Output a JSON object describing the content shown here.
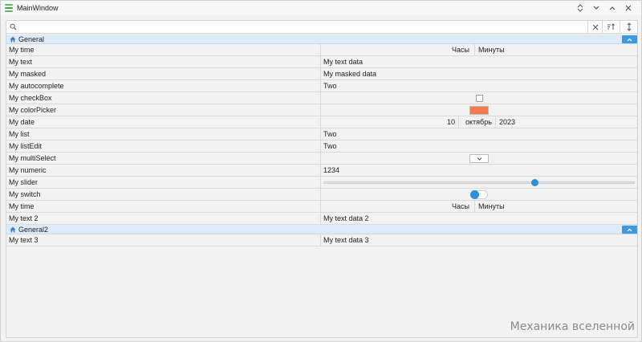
{
  "window": {
    "title": "MainWindow"
  },
  "search": {
    "value": "",
    "placeholder": ""
  },
  "groups": [
    {
      "title": "General",
      "rows": [
        {
          "name": "My time",
          "hours": "Часы",
          "minutes": "Минуты"
        },
        {
          "name": "My text",
          "value": "My text data"
        },
        {
          "name": "My masked",
          "value": "My masked data"
        },
        {
          "name": "My autocomplete",
          "value": "Two"
        },
        {
          "name": "My checkBox",
          "checked": false
        },
        {
          "name": "My colorPicker",
          "color": "#f7794f"
        },
        {
          "name": "My date",
          "day": "10",
          "month": "октябрь",
          "year": "2023"
        },
        {
          "name": "My list",
          "value": "Two"
        },
        {
          "name": "My listEdit",
          "value": "Two"
        },
        {
          "name": "My multiSelect"
        },
        {
          "name": "My numeric",
          "value": "1234"
        },
        {
          "name": "My slider",
          "level": 0.68
        },
        {
          "name": "My switch",
          "on": false
        },
        {
          "name": "My time",
          "hours": "Часы",
          "minutes": "Минуты"
        },
        {
          "name": "My text 2",
          "value": "My text data 2"
        }
      ]
    },
    {
      "title": "General2",
      "rows": [
        {
          "name": "My text 3",
          "value": "My text data 3"
        }
      ]
    }
  ],
  "watermark": "Механика вселенной",
  "colors": {
    "accent": "#3d9ae0",
    "group_bg": "#ddeaf8",
    "color_picker": "#f7794f"
  }
}
